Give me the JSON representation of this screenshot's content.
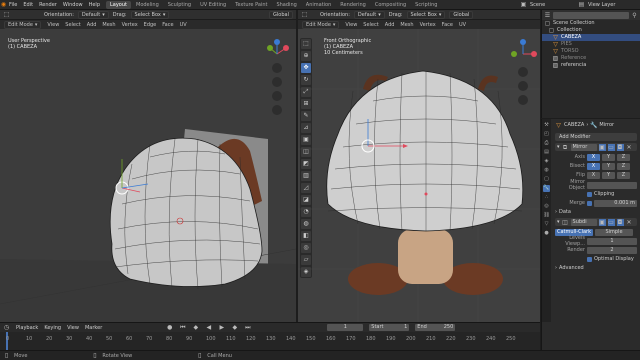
{
  "topbar": {
    "menus": [
      "File",
      "Edit",
      "Render",
      "Window",
      "Help"
    ],
    "workspaces": [
      "Layout",
      "Modeling",
      "Sculpting",
      "UV Editing",
      "Texture Paint",
      "Shading",
      "Animation",
      "Rendering",
      "Compositing",
      "Scripting"
    ],
    "active_workspace": "Layout",
    "scene": "Scene",
    "view_layer": "View Layer"
  },
  "left_viewport": {
    "orientation_label": "Orientation:",
    "orientation_value": "Default",
    "drag_label": "Drag:",
    "drag_value": "Select Box",
    "transform": "Global",
    "mode": "Edit Mode",
    "menus": [
      "View",
      "Select",
      "Add",
      "Mesh",
      "Vertex",
      "Edge",
      "Face",
      "UV"
    ],
    "view_title": "User Perspective",
    "object": "(1) CABEZA"
  },
  "right_viewport": {
    "orientation_label": "Orientation:",
    "orientation_value": "Default",
    "drag_label": "Drag:",
    "drag_value": "Select Box",
    "transform": "Global",
    "mode": "Edit Mode",
    "menus": [
      "View",
      "Select",
      "Add",
      "Mesh",
      "Vertex",
      "Face",
      "UV"
    ],
    "view_title": "Front Orthographic",
    "object": "(1) CABEZA",
    "scale": "10 Centimeters"
  },
  "outliner": {
    "header": "Scene Collection",
    "items": [
      {
        "label": "Collection",
        "selected": false
      },
      {
        "label": "CABEZA",
        "selected": true
      },
      {
        "label": "PIES",
        "selected": false
      },
      {
        "label": "TORSO",
        "selected": false
      },
      {
        "label": "Reference",
        "selected": false
      },
      {
        "label": "referencia",
        "selected": false
      }
    ]
  },
  "properties": {
    "object_name": "CABEZA",
    "modifier_name": "Mirror",
    "add_modifier": "Add Modifier",
    "mirror": {
      "name": "Mirror",
      "axis_label": "Axis",
      "bisect_label": "Bisect",
      "flip_label": "Flip",
      "axes": [
        "X",
        "Y",
        "Z"
      ],
      "mirror_object_label": "Mirror Object",
      "clipping_label": "Clipping",
      "merge_label": "Merge",
      "merge_value": "0.001 m",
      "data_label": "Data"
    },
    "subsurf": {
      "name": "Subdi",
      "catmull": "Catmull-Clark",
      "simple": "Simple",
      "levels_label": "Levels Viewp...",
      "levels_value": "1",
      "render_label": "Render",
      "render_value": "2",
      "optimal_label": "Optimal Display",
      "advanced_label": "Advanced"
    }
  },
  "timeline": {
    "menus": [
      "Playback",
      "Keying",
      "View",
      "Marker"
    ],
    "frame": "1",
    "start_label": "Start",
    "start_value": "1",
    "end_label": "End",
    "end_value": "250",
    "ruler": [
      "0",
      "10",
      "20",
      "30",
      "40",
      "50",
      "60",
      "70",
      "80",
      "90",
      "100",
      "110",
      "120",
      "130",
      "140",
      "150",
      "160",
      "170",
      "180",
      "190",
      "200",
      "210",
      "220",
      "230",
      "240",
      "250"
    ]
  },
  "statusbar": {
    "select": "Move",
    "rotate": "Rotate View",
    "menu": "Call Menu"
  },
  "colors": {
    "accent": "#4772b3",
    "selected_row": "#334d80",
    "viewport_bg": "#3c3c3c"
  }
}
